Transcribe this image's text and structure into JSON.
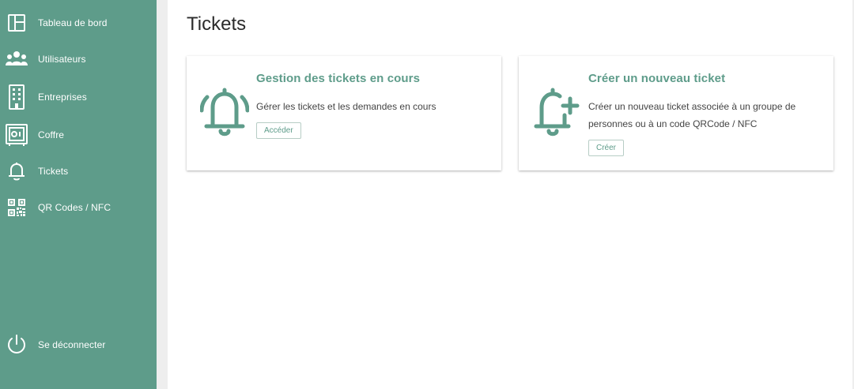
{
  "sidebar": {
    "items": [
      {
        "label": "Tableau de bord",
        "icon": "dashboard-icon"
      },
      {
        "label": "Utilisateurs",
        "icon": "users-icon"
      },
      {
        "label": "Entreprises",
        "icon": "building-icon"
      },
      {
        "label": "Coffre",
        "icon": "safe-icon"
      },
      {
        "label": "Tickets",
        "icon": "bell-icon"
      },
      {
        "label": "QR Codes / NFC",
        "icon": "qr-code-icon"
      }
    ],
    "logout": {
      "label": "Se déconnecter",
      "icon": "power-icon"
    }
  },
  "main": {
    "title": "Tickets",
    "cards": [
      {
        "title": "Gestion des tickets en cours",
        "description": "Gérer les tickets et les demandes en cours",
        "button": "Accéder",
        "icon": "bell-ringing-icon"
      },
      {
        "title": "Créer un nouveau ticket",
        "description": "Créer un nouveau ticket associée à un groupe de personnes ou à un code QRCode / NFC",
        "button": "Créer",
        "icon": "bell-plus-icon"
      }
    ]
  },
  "colors": {
    "accent": "#5e9c8a",
    "sidebar_background": "#5e9c8a",
    "page_background": "#ffffff"
  }
}
